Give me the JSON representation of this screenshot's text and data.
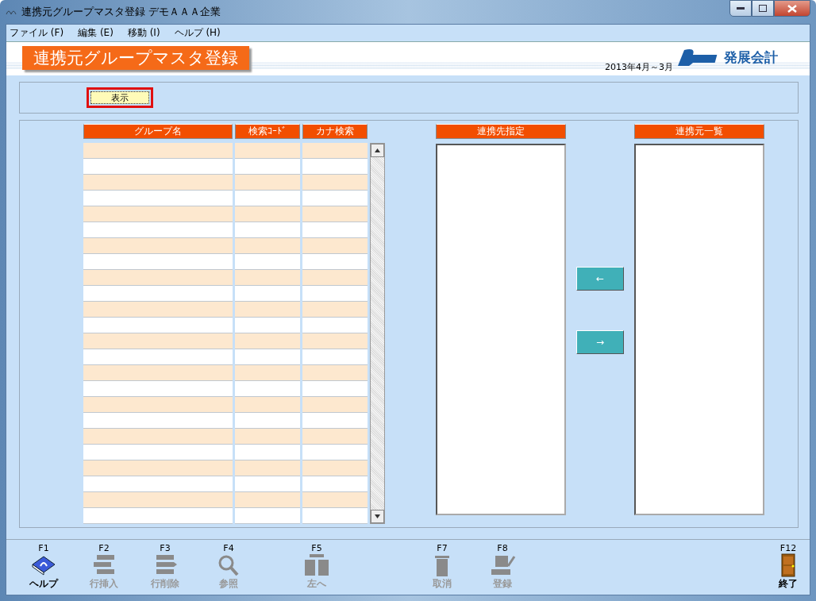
{
  "window": {
    "title": "連携元グループマスタ登録 デモＡＡＡ企業"
  },
  "menu": [
    "ファイル (F)",
    "編集 (E)",
    "移動 (I)",
    "ヘルプ (H)"
  ],
  "header": {
    "title": "連携元グループマスタ登録",
    "period": "2013年4月～3月",
    "brand": "発展会計"
  },
  "display_button": {
    "label": "表示",
    "selected": true
  },
  "table": {
    "columns": [
      "グループ名",
      "検索ｺｰﾄﾞ",
      "カナ検索"
    ]
  },
  "target_list": {
    "title": "連携先指定"
  },
  "source_list": {
    "title": "連携元一覧"
  },
  "move_buttons": [
    "←",
    "→"
  ],
  "function_keys": [
    {
      "key": "F1",
      "label": "ヘルプ",
      "kind": "help",
      "disabled": false
    },
    {
      "key": "F2",
      "label": "行挿入",
      "kind": "insert",
      "disabled": true
    },
    {
      "key": "F3",
      "label": "行削除",
      "kind": "delete",
      "disabled": true
    },
    {
      "key": "F4",
      "label": "参照",
      "kind": "search",
      "disabled": true
    },
    {
      "key": "F5",
      "label": "左へ",
      "kind": "left",
      "disabled": true
    },
    {
      "key": "F7",
      "label": "取消",
      "kind": "cancel",
      "disabled": true
    },
    {
      "key": "F8",
      "label": "登録",
      "kind": "register",
      "disabled": true
    },
    {
      "key": "F12",
      "label": "終了",
      "kind": "exit",
      "disabled": false
    }
  ]
}
